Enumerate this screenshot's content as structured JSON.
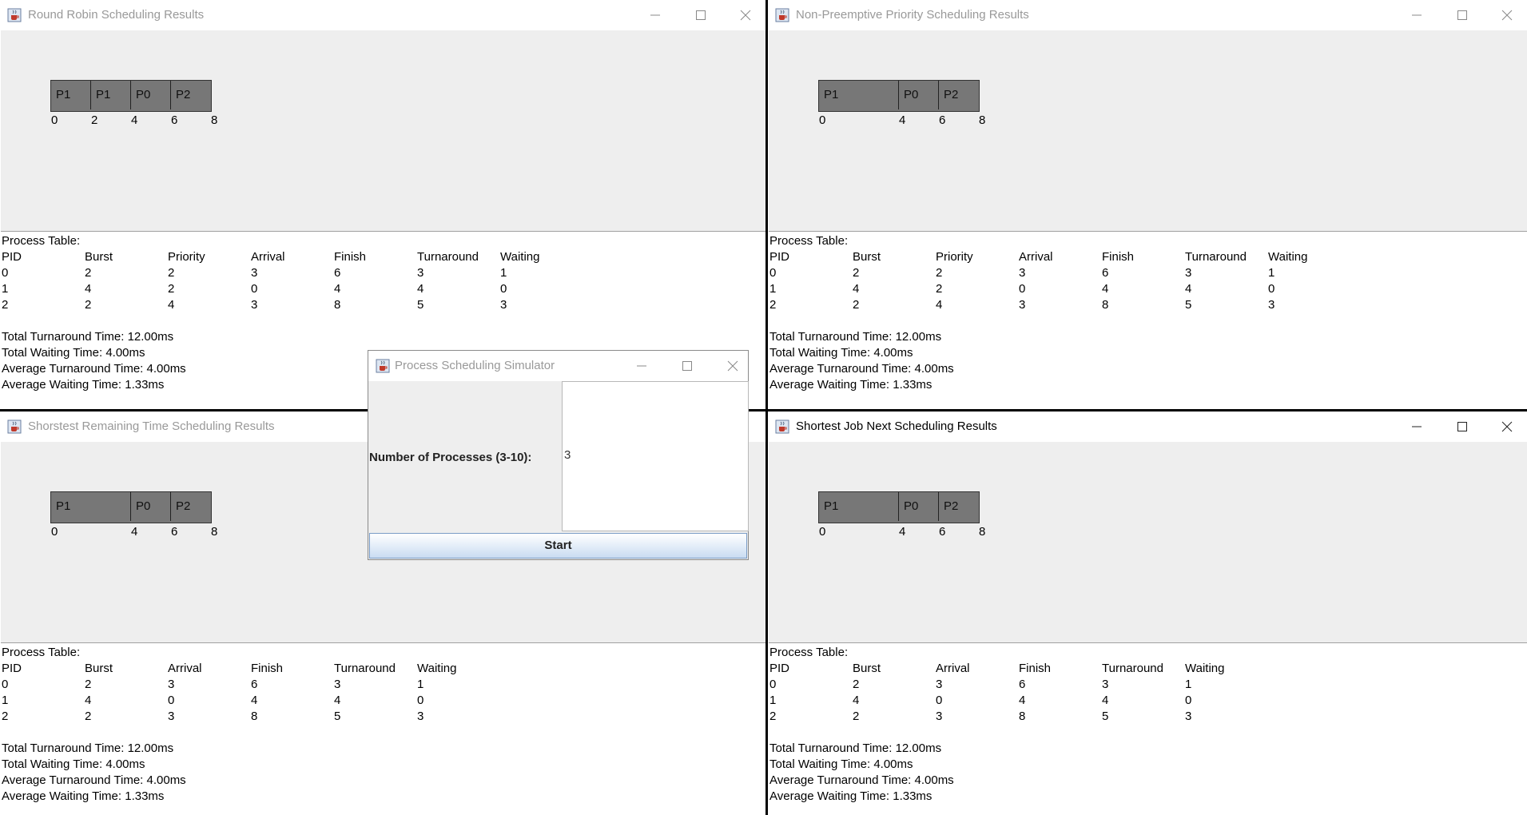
{
  "windows": {
    "rr": {
      "title": "Round Robin Scheduling Results",
      "gantt": {
        "blocks": [
          "P1",
          "P1",
          "P0",
          "P2"
        ],
        "ticks": [
          "0",
          "2",
          "4",
          "6",
          "8"
        ]
      },
      "table": {
        "caption": "Process Table:",
        "headers": [
          "PID",
          "Burst",
          "Priority",
          "Arrival",
          "Finish",
          "Turnaround",
          "Waiting"
        ],
        "rows": [
          [
            "0",
            "2",
            "2",
            "3",
            "6",
            "3",
            "1"
          ],
          [
            "1",
            "4",
            "2",
            "0",
            "4",
            "4",
            "0"
          ],
          [
            "2",
            "2",
            "4",
            "3",
            "8",
            "5",
            "3"
          ]
        ]
      },
      "summary": {
        "total_turnaround": "Total Turnaround Time: 12.00ms",
        "total_waiting": "Total Waiting Time: 4.00ms",
        "avg_turnaround": "Average Turnaround Time: 4.00ms",
        "avg_waiting": "Average Waiting Time: 1.33ms"
      }
    },
    "priority": {
      "title": "Non-Preemptive Priority Scheduling Results",
      "gantt": {
        "blocks": [
          "P1",
          "P0",
          "P2"
        ],
        "ticks": [
          "0",
          "4",
          "6",
          "8"
        ]
      },
      "table": {
        "caption": "Process Table:",
        "headers": [
          "PID",
          "Burst",
          "Priority",
          "Arrival",
          "Finish",
          "Turnaround",
          "Waiting"
        ],
        "rows": [
          [
            "0",
            "2",
            "2",
            "3",
            "6",
            "3",
            "1"
          ],
          [
            "1",
            "4",
            "2",
            "0",
            "4",
            "4",
            "0"
          ],
          [
            "2",
            "2",
            "4",
            "3",
            "8",
            "5",
            "3"
          ]
        ]
      },
      "summary": {
        "total_turnaround": "Total  Turnaround Time: 12.00ms",
        "total_waiting": "Total  Waiting Time: 4.00ms",
        "avg_turnaround": "Average Turnaround Time: 4.00ms",
        "avg_waiting": "Average Waiting Time: 1.33ms"
      }
    },
    "srt": {
      "title": "Shorstest Remaining Time Scheduling Results",
      "gantt": {
        "blocks": [
          "P1",
          "P0",
          "P2"
        ],
        "ticks": [
          "0",
          "4",
          "6",
          "8"
        ]
      },
      "table": {
        "caption": "Process Table:",
        "headers": [
          "PID",
          "Burst",
          "Arrival",
          "Finish",
          "Turnaround",
          "Waiting"
        ],
        "rows": [
          [
            "0",
            "2",
            "3",
            "6",
            "3",
            "1"
          ],
          [
            "1",
            "4",
            "0",
            "4",
            "4",
            "0"
          ],
          [
            "2",
            "2",
            "3",
            "8",
            "5",
            "3"
          ]
        ]
      },
      "summary": {
        "total_turnaround": "Total Turnaround Time: 12.00ms",
        "total_waiting": "Total Waiting Time: 4.00ms",
        "avg_turnaround": "Average Turnaround Time: 4.00ms",
        "avg_waiting": "Average Waiting Time: 1.33ms"
      }
    },
    "sjn": {
      "title": "Shortest Job Next Scheduling Results",
      "gantt": {
        "blocks": [
          "P1",
          "P0",
          "P2"
        ],
        "ticks": [
          "0",
          "4",
          "6",
          "8"
        ]
      },
      "table": {
        "caption": "Process Table:",
        "headers": [
          "PID",
          "Burst",
          "Arrival",
          "Finish",
          "Turnaround",
          "Waiting"
        ],
        "rows": [
          [
            "0",
            "2",
            "3",
            "6",
            "3",
            "1"
          ],
          [
            "1",
            "4",
            "0",
            "4",
            "4",
            "0"
          ],
          [
            "2",
            "2",
            "3",
            "8",
            "5",
            "3"
          ]
        ]
      },
      "summary": {
        "total_turnaround": "Total Turnaround Time: 12.00ms",
        "total_waiting": "Total Waiting Time: 4.00ms",
        "avg_turnaround": "Average Turnaround Time: 4.00ms",
        "avg_waiting": "Average Waiting Time: 1.33ms"
      }
    }
  },
  "dialog": {
    "title": "Process Scheduling Simulator",
    "label": "Number of Processes (3-10):",
    "value": "3",
    "start_label": "Start"
  },
  "icons": {
    "app": "java-cup-icon",
    "minimize": "minimize-icon",
    "maximize": "maximize-icon",
    "close": "close-icon"
  },
  "colors": {
    "gantt_block": "#777777",
    "panel_bg": "#eeeeee",
    "start_button_top": "#ffffff",
    "start_button_bottom": "#c9dcf2"
  }
}
